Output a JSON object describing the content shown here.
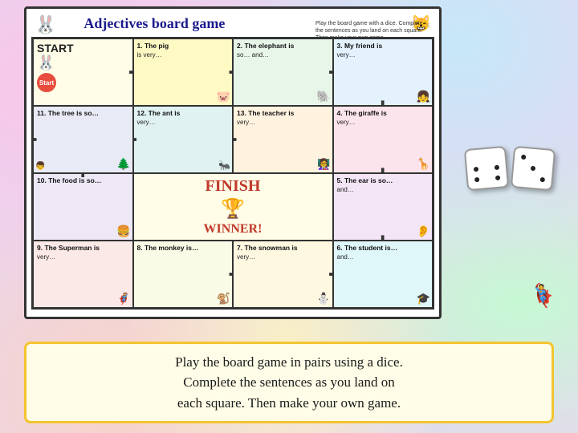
{
  "page": {
    "background_color": "#e8d5f0"
  },
  "board": {
    "title": "Adjectives board game",
    "subtitle": "Play the board game with a dice. Complete the sentences as you land on each square. Then make your own game.",
    "cells": [
      {
        "id": "start",
        "label": "START",
        "text": "",
        "type": "start",
        "row": 0,
        "col": 0
      },
      {
        "id": "1",
        "label": "1. The pig",
        "text": "is very…",
        "type": "normal",
        "row": 0,
        "col": 1
      },
      {
        "id": "2",
        "label": "2. The elephant is",
        "text": "so… and…",
        "type": "normal",
        "row": 0,
        "col": 2
      },
      {
        "id": "3",
        "label": "3. My friend is",
        "text": "very…",
        "type": "normal",
        "row": 0,
        "col": 3
      },
      {
        "id": "11",
        "label": "11. The tree is so…",
        "text": "",
        "type": "normal",
        "row": 1,
        "col": 0
      },
      {
        "id": "12",
        "label": "12. The ant is",
        "text": "very…",
        "type": "normal",
        "row": 1,
        "col": 1
      },
      {
        "id": "13",
        "label": "13. The teacher is",
        "text": "very…",
        "type": "normal",
        "row": 1,
        "col": 2
      },
      {
        "id": "4",
        "label": "4. The giraffe is",
        "text": "very…",
        "type": "normal",
        "row": 1,
        "col": 3
      },
      {
        "id": "10",
        "label": "10. The food is so…",
        "text": "",
        "type": "normal",
        "row": 2,
        "col": 0
      },
      {
        "id": "finish",
        "label": "FINISH",
        "text": "WINNER!",
        "type": "finish",
        "row": 2,
        "col": 1
      },
      {
        "id": "finish2",
        "label": "",
        "text": "",
        "type": "finish_ext",
        "row": 2,
        "col": 2
      },
      {
        "id": "5",
        "label": "5. The ear is so…",
        "text": "and…",
        "type": "normal",
        "row": 2,
        "col": 3
      },
      {
        "id": "9",
        "label": "9. The Superman is",
        "text": "very…",
        "type": "normal",
        "row": 3,
        "col": 0
      },
      {
        "id": "8",
        "label": "8. The monkey is…",
        "text": "",
        "type": "normal",
        "row": 3,
        "col": 1
      },
      {
        "id": "7",
        "label": "7. The snowman is",
        "text": "very…",
        "type": "normal",
        "row": 3,
        "col": 2
      },
      {
        "id": "6",
        "label": "6. The student is…",
        "text": "and…",
        "type": "normal",
        "row": 3,
        "col": 3
      }
    ]
  },
  "bottom_text": {
    "line1": "Play the board game in pairs using a dice.",
    "line2": "Complete the sentences as you land on",
    "line3": "each square. Then make your own game."
  },
  "dice": {
    "label": "dice image"
  }
}
